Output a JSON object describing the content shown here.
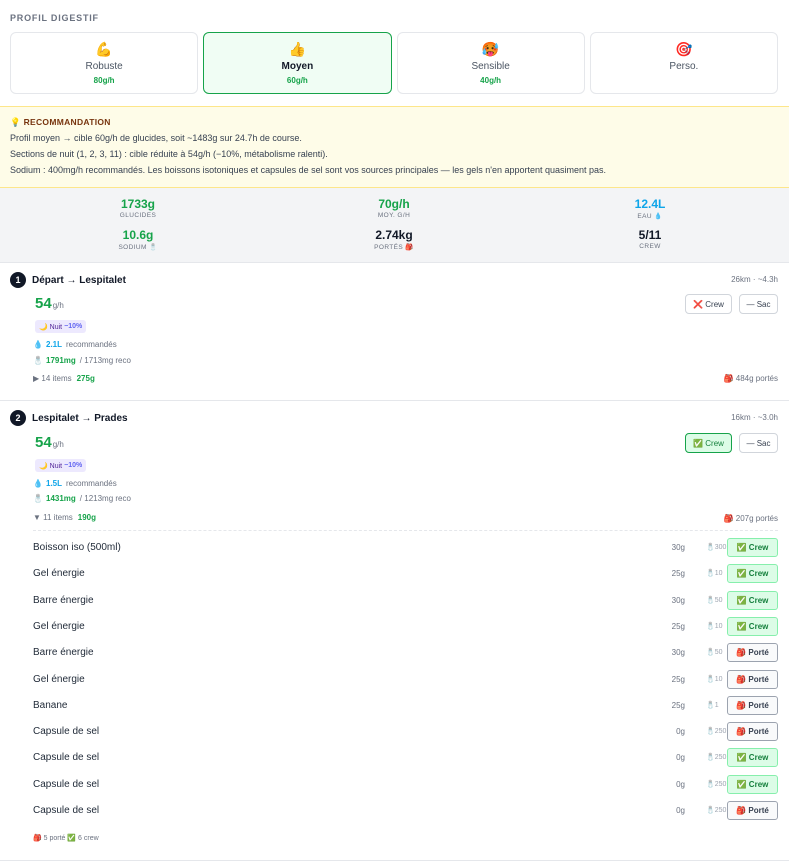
{
  "section_title": "PROFIL DIGESTIF",
  "profiles": [
    {
      "emoji": "💪",
      "name": "Robuste",
      "rate": "80g/h"
    },
    {
      "emoji": "👍",
      "name": "Moyen",
      "rate": "60g/h"
    },
    {
      "emoji": "🥵",
      "name": "Sensible",
      "rate": "40g/h"
    },
    {
      "emoji": "🎯",
      "name": "Perso.",
      "rate": ""
    }
  ],
  "active_profile": "Moyen",
  "reco": {
    "icon": "💡",
    "title": "RECOMMANDATION",
    "lines": [
      "Profil moyen → cible 60g/h de glucides, soit ~1483g sur 24.7h de course.",
      "Sections de nuit (1, 2, 3, 11) : cible réduite à 54g/h (−10%, métabolisme ralenti).",
      "Sodium : 400mg/h recommandés. Les boissons isotoniques et capsules de sel sont vos sources principales — les gels n'en apportent quasiment pas."
    ]
  },
  "stats": {
    "glucides": {
      "value": "1733g",
      "label": "GLUCIDES"
    },
    "moy": {
      "value": "70g/h",
      "label": "MOY. G/H"
    },
    "eau": {
      "value": "12.4L",
      "label": "EAU 💧"
    },
    "sodium": {
      "value": "10.6g",
      "label": "SODIUM 🧂"
    },
    "portes": {
      "value": "2.74kg",
      "label": "PORTÉS 🎒"
    },
    "crew": {
      "value": "5/11",
      "label": "CREW"
    }
  },
  "segments": [
    {
      "num": "1",
      "title": "Départ → Lespitalet",
      "meta": "26km · ~4.3h",
      "rate": "54",
      "rate_unit": "g/h",
      "night_label": "🌙 Nuit",
      "night_value": "−10%",
      "water": "2.1L",
      "water_suffix": "recommandés",
      "sodium": "1791mg",
      "sodium_reco": "/ 1713mg reco",
      "items_label": "▶ 14 items",
      "items_g": "275g",
      "ported": "🎒 484g portés",
      "crew_btn": "❌ Crew",
      "sac_btn": "— Sac"
    },
    {
      "num": "2",
      "title": "Lespitalet → Prades",
      "meta": "16km · ~3.0h",
      "rate": "54",
      "rate_unit": "g/h",
      "night_label": "🌙 Nuit",
      "night_value": "−10%",
      "water": "1.5L",
      "water_suffix": "recommandés",
      "sodium": "1431mg",
      "sodium_reco": "/ 1213mg reco",
      "items_label": "▼ 11 items",
      "items_g": "190g",
      "ported": "🎒 207g portés",
      "crew_btn": "✅ Crew",
      "sac_btn": "— Sac",
      "items": [
        {
          "name": "Boisson iso (500ml)",
          "g": "30g",
          "na": "🧂300",
          "status": "✅ Crew",
          "kind": "crew"
        },
        {
          "name": "Gel énergie",
          "g": "25g",
          "na": "🧂10",
          "status": "✅ Crew",
          "kind": "crew"
        },
        {
          "name": "Barre énergie",
          "g": "30g",
          "na": "🧂50",
          "status": "✅ Crew",
          "kind": "crew"
        },
        {
          "name": "Gel énergie",
          "g": "25g",
          "na": "🧂10",
          "status": "✅ Crew",
          "kind": "crew"
        },
        {
          "name": "Barre énergie",
          "g": "30g",
          "na": "🧂50",
          "status": "🎒 Porté",
          "kind": "porte"
        },
        {
          "name": "Gel énergie",
          "g": "25g",
          "na": "🧂10",
          "status": "🎒 Porté",
          "kind": "porte"
        },
        {
          "name": "Banane",
          "g": "25g",
          "na": "🧂1",
          "status": "🎒 Porté",
          "kind": "porte"
        },
        {
          "name": "Capsule de sel",
          "g": "0g",
          "na": "🧂250",
          "status": "🎒 Porté",
          "kind": "porte"
        },
        {
          "name": "Capsule de sel",
          "g": "0g",
          "na": "🧂250",
          "status": "✅ Crew",
          "kind": "crew"
        },
        {
          "name": "Capsule de sel",
          "g": "0g",
          "na": "🧂250",
          "status": "✅ Crew",
          "kind": "crew"
        },
        {
          "name": "Capsule de sel",
          "g": "0g",
          "na": "🧂250",
          "status": "🎒 Porté",
          "kind": "porte"
        }
      ],
      "summary": "🎒 5 porté  ✅ 6 crew"
    }
  ],
  "colors": {
    "accent": "#16a34a",
    "water": "#0ea5e9",
    "reco_bg": "#fefce8",
    "night": "#6366f1"
  }
}
